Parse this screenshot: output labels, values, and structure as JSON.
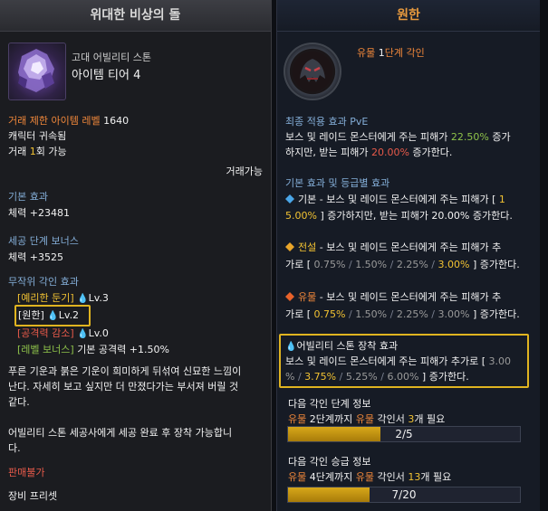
{
  "left": {
    "title": "위대한 비상의 돌",
    "category": "고대 어빌리티 스톤",
    "tier": "아이템 티어 4",
    "level_req_label": "거래 제한 아이템 레벨",
    "level_req_value": "1640",
    "bound": "캐릭터 귀속됨",
    "trade_prefix": "거래",
    "trade_count": "1",
    "trade_suffix": "회 가능",
    "tradeable": "거래가능",
    "base_effect_label": "기본 효과",
    "base_stat": "체력 +23481",
    "craft_bonus_label": "세공 단계 보너스",
    "craft_bonus_stat": "체력 +3525",
    "random_label": "무작위 각인 효과",
    "engravings": [
      {
        "name": "[예리한 둔기]",
        "level": "Lv.3"
      },
      {
        "name": "[원한]",
        "level": "Lv.2"
      },
      {
        "name": "[공격력 감소]",
        "level": "Lv.0"
      }
    ],
    "level_bonus_name": "[레벨 보너스]",
    "level_bonus_text": "기본 공격력 +1.50%",
    "flavor_line1": "푸른 기운과 붉은 기운이 희미하게 뒤섞여 신묘한 느낌이",
    "flavor_line2": "난다. 자세히 보고 싶지만 더 만졌다가는 부서져 버릴 것",
    "flavor_line3": "같다.",
    "note_line1": "어빌리티 스톤 세공사에게 세공 완료 후 장착 가능합니",
    "note_line2": "다.",
    "not_sellable": "판매불가",
    "preset": "장비 프리셋"
  },
  "right": {
    "title": "원한",
    "stage_prefix": "유물",
    "stage_num": "1",
    "stage_suffix": "단계 각인",
    "final_label": "최종 적용 효과",
    "final_pve": "PvE",
    "final_line1_a": "보스 및 레이드 몬스터에게 주는 피해가",
    "final_line1_val": "22.50%",
    "final_line1_b": "증가",
    "final_line2_a": "하지만, 받는 피해가",
    "final_line2_val": "20.00%",
    "final_line2_b": "증가한다.",
    "grade_label": "기본 효과 및 등급별 효과",
    "basic_line1_tag": "기본",
    "basic_line1_text": " - 보스 및 레이드 몬스터에게 주는 피해가 [",
    "basic_line1_val": "1",
    "basic_line2_val": "5.00%",
    "basic_line2_text": "] 증가하지만, 받는 피해가 20.00% 증가한다.",
    "legend_tag": "전설",
    "legend_line1": " - 보스 및 레이드 몬스터에게 주는 피해가 추",
    "legend_line2_pre": "가로 [",
    "legend_vals": [
      "0.75%",
      "1.50%",
      "2.25%",
      "3.00%"
    ],
    "legend_line2_post": "] 증가한다.",
    "relic_tag": "유물",
    "relic_line1": " - 보스 및 레이드 몬스터에게 주는 피해가 추",
    "relic_line2_pre": "가로 [",
    "relic_vals": [
      "0.75%",
      "1.50%",
      "2.25%",
      "3.00%"
    ],
    "relic_line2_post": "] 증가한다.",
    "stone_label": "어빌리티 스톤 장착 효과",
    "stone_line1_a": "보스 및 레이드 몬스터에게 주는 피해가 추가로 [",
    "stone_line1_val": "3.00",
    "stone_line2_vals": [
      "%",
      "3.75%",
      "5.25%",
      "6.00%"
    ],
    "stone_line2_post": "] 증가한다.",
    "next_stage_label": "다음 각인 단계 정보",
    "next_stage_a": "유물",
    "next_stage_b": "2단계까지",
    "next_stage_c": "유물",
    "next_stage_d": "각인서",
    "next_stage_n": "3",
    "next_stage_e": "개 필요",
    "bar1_text": "2/5",
    "bar1_progress": 0.4,
    "next_grade_label": "다음 각인 승급 정보",
    "next_grade_a": "유물",
    "next_grade_b": "4단계까지",
    "next_grade_c": "유물",
    "next_grade_d": "각인서",
    "next_grade_n": "13",
    "next_grade_e": "개 필요",
    "bar2_text": "7/20",
    "bar2_progress": 0.35
  }
}
